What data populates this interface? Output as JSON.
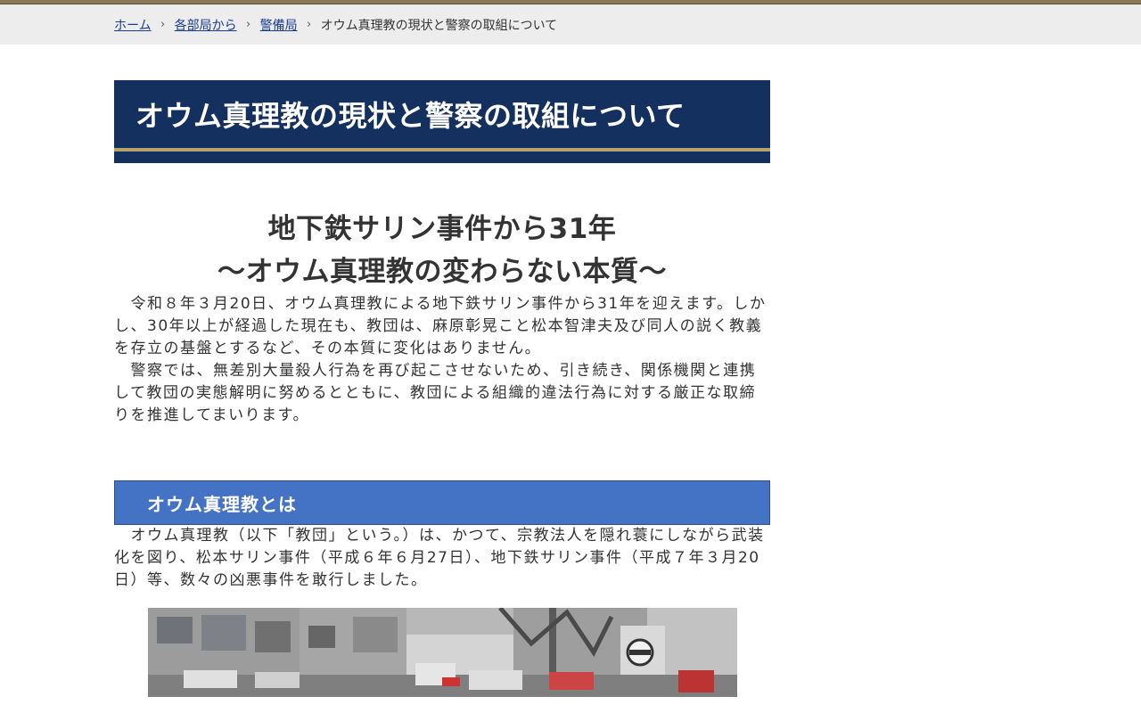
{
  "breadcrumb": {
    "items": [
      "ホーム",
      "各部局から",
      "警備局"
    ],
    "separator": "›",
    "current": "オウム真理教の現状と警察の取組について"
  },
  "page": {
    "title": "オウム真理教の現状と警察の取組について"
  },
  "lead": {
    "title_line1": "地下鉄サリン事件から31年",
    "title_line2": "～オウム真理教の変わらない本質～",
    "paragraph1": "　令和８年３月20日、オウム真理教による地下鉄サリン事件から31年を迎えます。しかし、30年以上が経過した現在も、教団は、麻原彰晃こと松本智津夫及び同人の説く教義を存立の基盤とするなど、その本質に変化はありません。",
    "paragraph2": "　警察では、無差別大量殺人行為を再び起こさせないため、引き続き、関係機関と連携して教団の実態解明に努めるとともに、教団による組織的違法行為に対する厳正な取締りを推進してまいります。"
  },
  "section1": {
    "heading": "オウム真理教とは",
    "paragraph": "　オウム真理教（以下「教団」という。）は、かつて、宗教法人を隠れ蓑にしながら武装化を図り、松本サリン事件（平成６年６月27日）、地下鉄サリン事件（平成７年３月20日）等、数々の凶悪事件を敢行しました。"
  }
}
